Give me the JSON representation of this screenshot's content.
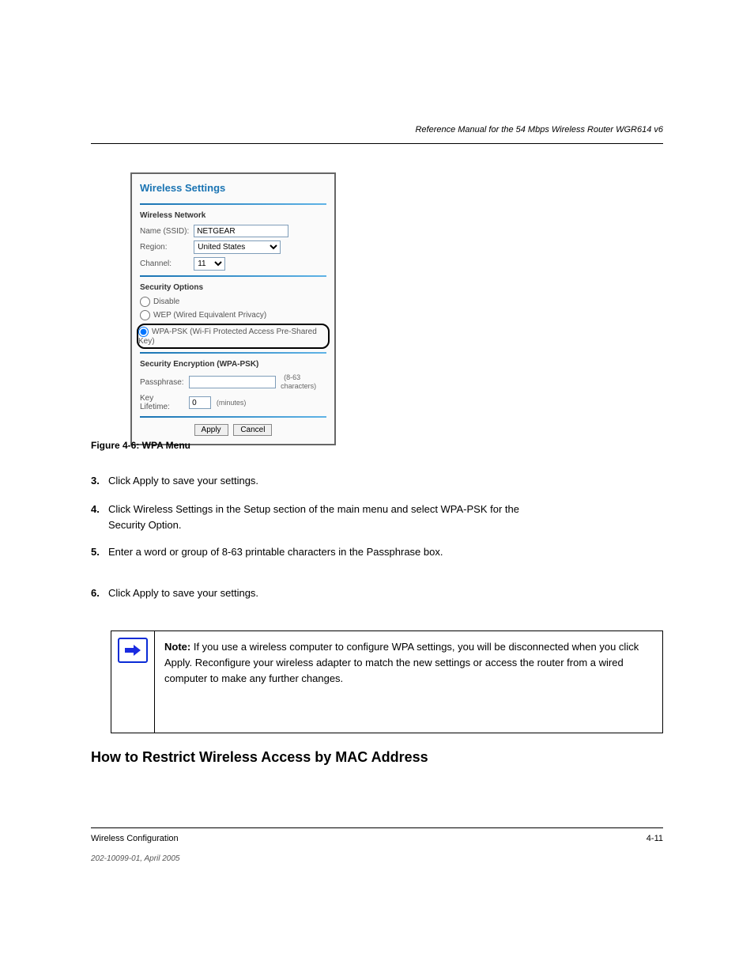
{
  "header": {
    "manual_title": "Reference Manual for the 54 Mbps Wireless Router WGR614 v6"
  },
  "footer": {
    "left": "Wireless Configuration",
    "right": "4-11",
    "version": "202-10099-01, April 2005"
  },
  "shot": {
    "title": "Wireless Settings",
    "section_network": "Wireless Network",
    "name_label": "Name (SSID):",
    "name_value": "NETGEAR",
    "region_label": "Region:",
    "region_value": "United States",
    "channel_label": "Channel:",
    "channel_value": "11",
    "section_security": "Security Options",
    "opt_disable": "Disable",
    "opt_wep": "WEP (Wired Equivalent Privacy)",
    "opt_wpa": "WPA-PSK (Wi-Fi Protected Access Pre-Shared Key)",
    "section_enc": "Security Encryption (WPA-PSK)",
    "pass_label": "Passphrase:",
    "pass_hint": "(8-63 characters)",
    "life_label": "Key Lifetime:",
    "life_value": "0",
    "life_unit": "(minutes)",
    "btn_apply": "Apply",
    "btn_cancel": "Cancel"
  },
  "figure_caption": "Figure 4-6:   WPA Menu",
  "body": {
    "step3": "Click Apply to save your settings.",
    "step4_l1": "Click Wireless Settings in the Setup section of the main menu and select WPA-PSK for the",
    "step4_l2": "Security Option.",
    "step5": "Enter a word or group of 8-63 printable characters in the Passphrase box.",
    "step6": "Click Apply to save your settings.",
    "note": "If you use a wireless computer to configure WPA settings, you will be disconnected when you click Apply. Reconfigure your wireless adapter to match the new settings or access the router from a wired computer to make any further changes.",
    "last_heading": "How to Restrict Wireless Access by MAC Address"
  }
}
